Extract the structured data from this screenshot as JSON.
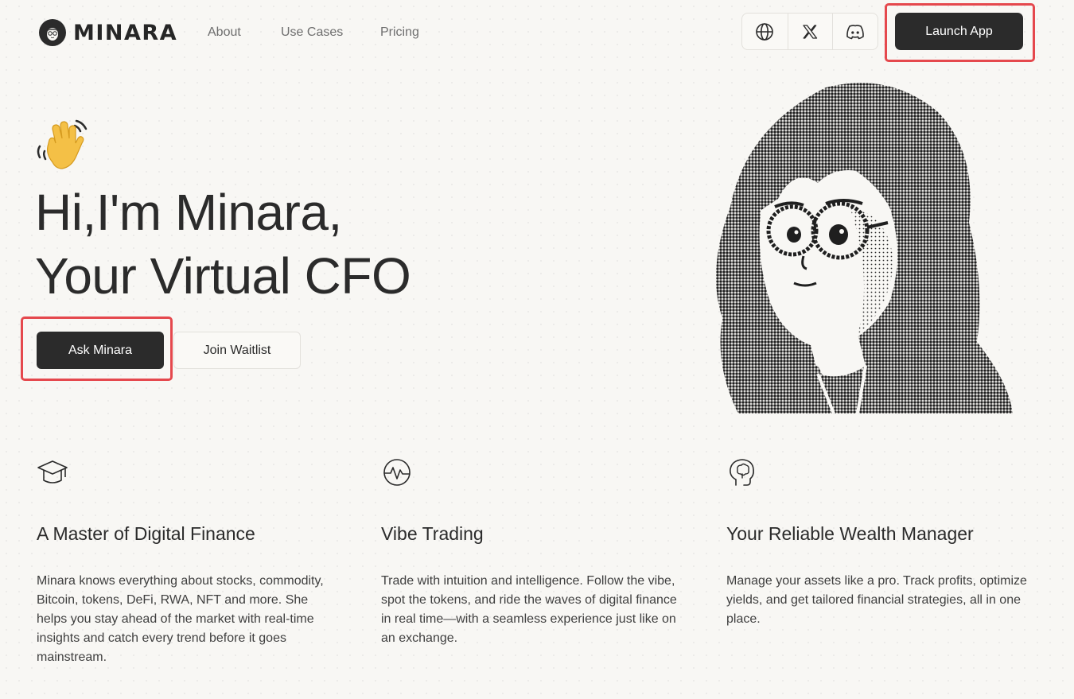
{
  "header": {
    "brand": "MINARA",
    "nav": [
      "About",
      "Use Cases",
      "Pricing"
    ],
    "launch_label": "Launch App"
  },
  "icons": {
    "language": "globe-icon",
    "x": "x-icon",
    "discord": "discord-icon"
  },
  "hero": {
    "line1": "Hi,I'm Minara,",
    "line2": "Your Virtual CFO",
    "primary_cta": "Ask Minara",
    "secondary_cta": "Join Waitlist"
  },
  "features": [
    {
      "icon": "graduation-cap-icon",
      "title": "A Master of Digital Finance",
      "desc": "Minara knows everything about stocks, commodity, Bitcoin, tokens, DeFi, RWA, NFT and more. She helps you stay ahead of the market with real-time insights and catch every trend before it goes mainstream."
    },
    {
      "icon": "pulse-icon",
      "title": "Vibe Trading",
      "desc": "Trade with intuition and intelligence. Follow the vibe, spot the tokens, and ride the waves of digital finance in real time—with a seamless experience just like on an exchange."
    },
    {
      "icon": "brain-head-icon",
      "title": "Your Reliable Wealth Manager",
      "desc": "Manage your assets like a pro. Track profits, optimize yields, and get tailored financial strategies, all in one place."
    }
  ],
  "colors": {
    "background": "#f8f7f4",
    "primary": "#2b2b2b",
    "highlight": "#e5484d"
  }
}
